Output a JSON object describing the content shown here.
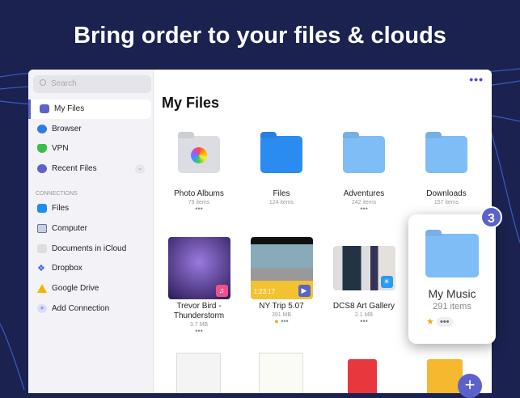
{
  "headline": "Bring order to your files & clouds",
  "sidebar": {
    "search_placeholder": "Search",
    "items": [
      {
        "label": "My Files"
      },
      {
        "label": "Browser"
      },
      {
        "label": "VPN"
      },
      {
        "label": "Recent Files"
      }
    ],
    "section": "CONNECTIONS",
    "connections": [
      {
        "label": "Files"
      },
      {
        "label": "Computer"
      },
      {
        "label": "Documents in iCloud"
      },
      {
        "label": "Dropbox"
      },
      {
        "label": "Google Drive"
      },
      {
        "label": "Add Connection"
      }
    ]
  },
  "main": {
    "title": "My Files",
    "more": "•••",
    "folders": [
      {
        "name": "Photo Albums",
        "count": "79 items"
      },
      {
        "name": "Files",
        "count": "124 items"
      },
      {
        "name": "Adventures",
        "count": "242 items"
      },
      {
        "name": "Downloads",
        "count": "157 items"
      }
    ],
    "files": [
      {
        "name": "Trevor Bird - Thunderstorm",
        "size": "3.7 MB"
      },
      {
        "name": "NY Trip 5.07",
        "size": "391 MB",
        "duration": "1:23:17"
      },
      {
        "name": "DCS8 Art Gallery",
        "size": "2.1 MB"
      }
    ],
    "dragged": {
      "name": "My Music",
      "count": "291 items",
      "stack_count": "3"
    },
    "dots": "•••"
  }
}
